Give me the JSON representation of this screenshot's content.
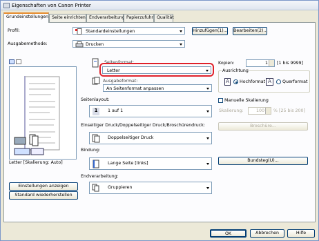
{
  "window": {
    "title": "Eigenschaften von Canon Printer"
  },
  "tabs": [
    {
      "label": "Grundeinstellungen",
      "active": true
    },
    {
      "label": "Seite einrichten"
    },
    {
      "label": "Endverarbeitung"
    },
    {
      "label": "Papierzufuhr"
    },
    {
      "label": "Qualität"
    }
  ],
  "profile": {
    "label": "Profil:",
    "value": "Standardeinstellungen",
    "add_button": "Hinzufügen(1)...",
    "edit_button": "Bearbeiten(2)..."
  },
  "output_method": {
    "label": "Ausgabemethode:",
    "value": "Drucken"
  },
  "preview": {
    "caption": "Letter [Skalierung: Auto]"
  },
  "page_format": {
    "label": "Seitenformat:",
    "value": "Letter"
  },
  "output_format": {
    "label": "Ausgabeformat:",
    "value": "An Seitenformat anpassen"
  },
  "copies": {
    "label": "Kopien:",
    "value": "1",
    "range": "[1 bis 9999]"
  },
  "orientation": {
    "label": "Ausrichtung",
    "portrait": "Hochformat",
    "landscape": "Querformat",
    "selected": "portrait"
  },
  "page_layout": {
    "label": "Seitenlayout:",
    "value": "1 auf 1"
  },
  "manual_scaling": {
    "label": "Manuelle Skalierung",
    "scaling_label": "Skalierung:",
    "scaling_value": "100",
    "scaling_range": "% [25 bis 200]",
    "brochure_button": "Broschüre..."
  },
  "duplex": {
    "label": "Einseitiger Druck/Doppelseitiger Druck/Broschürendruck:",
    "value": "Doppelseitiger Druck"
  },
  "binding": {
    "label": "Bindung:",
    "value": "Lange Seite [links]",
    "gutter_button": "Bundsteg(U)..."
  },
  "finishing": {
    "label": "Endverarbeitung:",
    "value": "Gruppieren"
  },
  "left_buttons": {
    "show_settings": "Einstellungen anzeigen",
    "restore_defaults": "Standard wiederherstellen"
  },
  "footer": {
    "ok": "OK",
    "cancel": "Abbrechen",
    "help": "Hilfe"
  },
  "colors": {
    "highlight": "#e0212a",
    "accent": "#e68b2c",
    "border": "#7f9db9"
  }
}
